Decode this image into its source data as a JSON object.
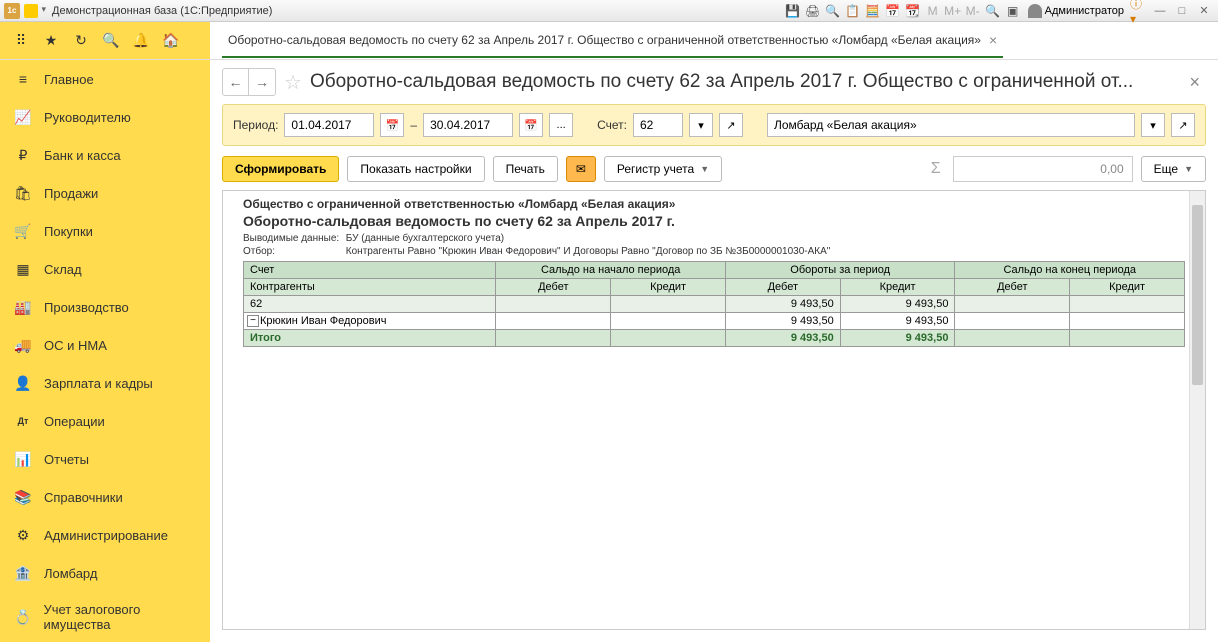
{
  "titlebar": {
    "title": "Демонстрационная база  (1С:Предприятие)",
    "admin_label": "Администратор"
  },
  "tab": {
    "label": "Оборотно-сальдовая ведомость по счету 62 за Апрель 2017 г. Общество с ограниченной ответственностью «Ломбард «Белая акация»"
  },
  "sidebar": {
    "items": [
      {
        "icon": "≡",
        "label": "Главное"
      },
      {
        "icon": "📈",
        "label": "Руководителю"
      },
      {
        "icon": "₽",
        "label": "Банк и касса"
      },
      {
        "icon": "🛍",
        "label": "Продажи"
      },
      {
        "icon": "🛒",
        "label": "Покупки"
      },
      {
        "icon": "▦",
        "label": "Склад"
      },
      {
        "icon": "🏭",
        "label": "Производство"
      },
      {
        "icon": "🚚",
        "label": "ОС и НМА"
      },
      {
        "icon": "👤",
        "label": "Зарплата и кадры"
      },
      {
        "icon": "Дт",
        "label": "Операции"
      },
      {
        "icon": "📊",
        "label": "Отчеты"
      },
      {
        "icon": "📚",
        "label": "Справочники"
      },
      {
        "icon": "⚙",
        "label": "Администрирование"
      },
      {
        "icon": "🏦",
        "label": "Ломбард"
      },
      {
        "icon": "💍",
        "label": "Учет залогового имущества"
      }
    ]
  },
  "page": {
    "title": "Оборотно-сальдовая ведомость по счету 62 за Апрель 2017 г. Общество с ограниченной от..."
  },
  "filter": {
    "period_label": "Период:",
    "date_from": "01.04.2017",
    "dash": "–",
    "date_to": "30.04.2017",
    "account_label": "Счет:",
    "account": "62",
    "org": "Ломбард «Белая акация»"
  },
  "actions": {
    "generate": "Сформировать",
    "show_settings": "Показать настройки",
    "print": "Печать",
    "register": "Регистр учета",
    "more": "Еще",
    "sum_placeholder": "0,00"
  },
  "report": {
    "org": "Общество с ограниченной ответственностью «Ломбард «Белая акация»",
    "title": "Оборотно-сальдовая ведомость по счету 62 за Апрель 2017 г.",
    "meta1_label": "Выводимые данные:",
    "meta1_value": "БУ (данные бухгалтерского учета)",
    "meta2_label": "Отбор:",
    "meta2_value": "Контрагенты Равно \"Крюкин Иван Федорович\" И Договоры Равно \"Договор по ЗБ №ЗБ0000001030-АКА\"",
    "headers": {
      "account": "Счет",
      "contragents": "Контрагенты",
      "saldo_start": "Сальдо на начало периода",
      "turnover": "Обороты за период",
      "saldo_end": "Сальдо на конец периода",
      "debit": "Дебет",
      "credit": "Кредит"
    },
    "rows": [
      {
        "name": "62",
        "t_debit": "9 493,50",
        "t_credit": "9 493,50",
        "class": "acc-row"
      },
      {
        "name": "Крюкин Иван Федорович",
        "t_debit": "9 493,50",
        "t_credit": "9 493,50",
        "class": ""
      }
    ],
    "total": {
      "name": "Итого",
      "t_debit": "9 493,50",
      "t_credit": "9 493,50"
    }
  }
}
